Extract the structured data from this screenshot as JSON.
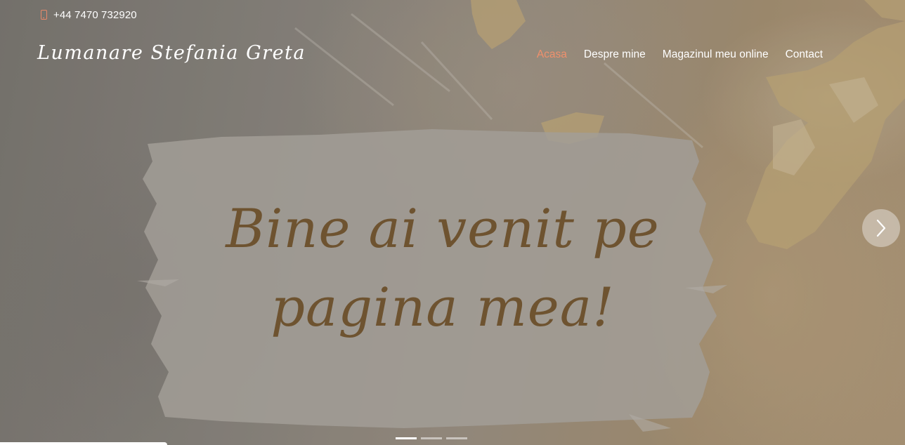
{
  "topbar": {
    "phone_icon": "mobile-phone-icon",
    "phone": "+44 7470 732920"
  },
  "header": {
    "logo": "Lumanare Stefania Greta",
    "nav": [
      {
        "label": "Acasa",
        "active": true
      },
      {
        "label": "Despre mine",
        "active": false
      },
      {
        "label": "Magazinul meu online",
        "active": false
      },
      {
        "label": "Contact",
        "active": false
      }
    ]
  },
  "hero": {
    "headline_line1": "Bine ai venit pe",
    "headline_line2": "pagina mea!",
    "next_icon": "chevron-right-icon",
    "slides_total": 3,
    "active_slide": 1
  },
  "colors": {
    "accent": "#f0906c",
    "headline": "#6e5330",
    "nav_text": "#ffffff"
  }
}
